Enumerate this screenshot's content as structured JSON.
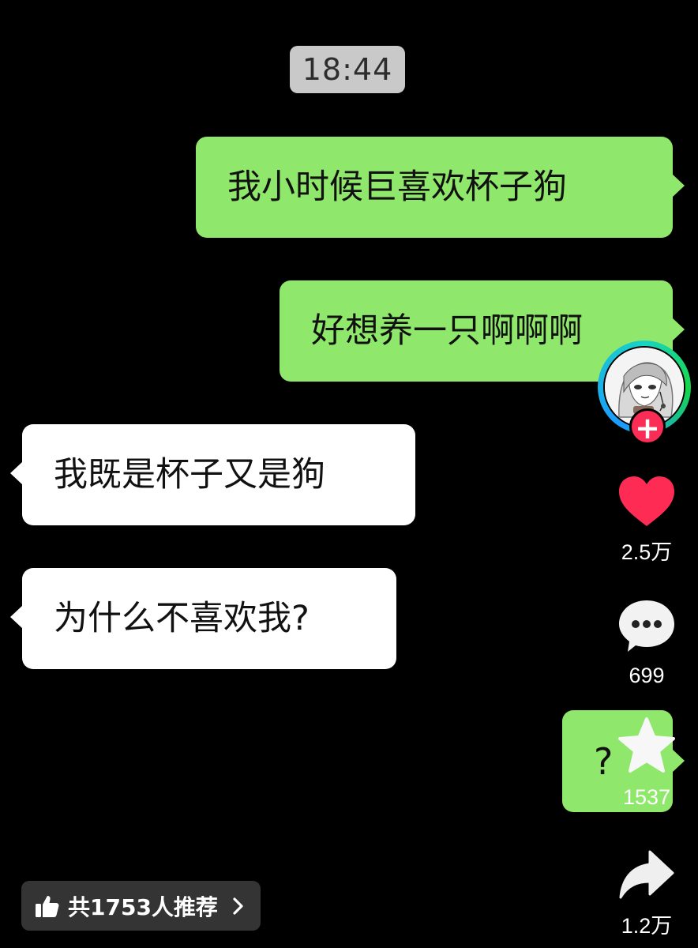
{
  "chat": {
    "timestamp": "18:44",
    "messages": [
      {
        "side": "right",
        "text": "我小时候巨喜欢杯子狗"
      },
      {
        "side": "right",
        "text": "好想养一只啊啊啊"
      },
      {
        "side": "left",
        "text": "我既是杯子又是狗"
      },
      {
        "side": "left",
        "text": "为什么不喜欢我?"
      },
      {
        "side": "right",
        "text": "?"
      }
    ]
  },
  "rail": {
    "follow_symbol": "+",
    "like_count": "2.5万",
    "comment_count": "699",
    "favorite_count": "1537",
    "share_count": "1.2万",
    "icons": {
      "like": "heart-icon",
      "comment": "comment-bubble-icon",
      "favorite": "star-icon",
      "share": "share-arrow-icon"
    },
    "colors": {
      "like": "#fe2c55",
      "follow": "#fb2c55",
      "ring": "#19d4c3"
    }
  },
  "recommend": {
    "label": "共1753人推荐",
    "icon": "thumbs-up-icon",
    "chevron": "chevron-right-icon"
  },
  "colors": {
    "background": "#000000",
    "right_bubble": "#8fe86b",
    "left_bubble": "#ffffff",
    "timestamp_bg": "#c9c9c9"
  }
}
